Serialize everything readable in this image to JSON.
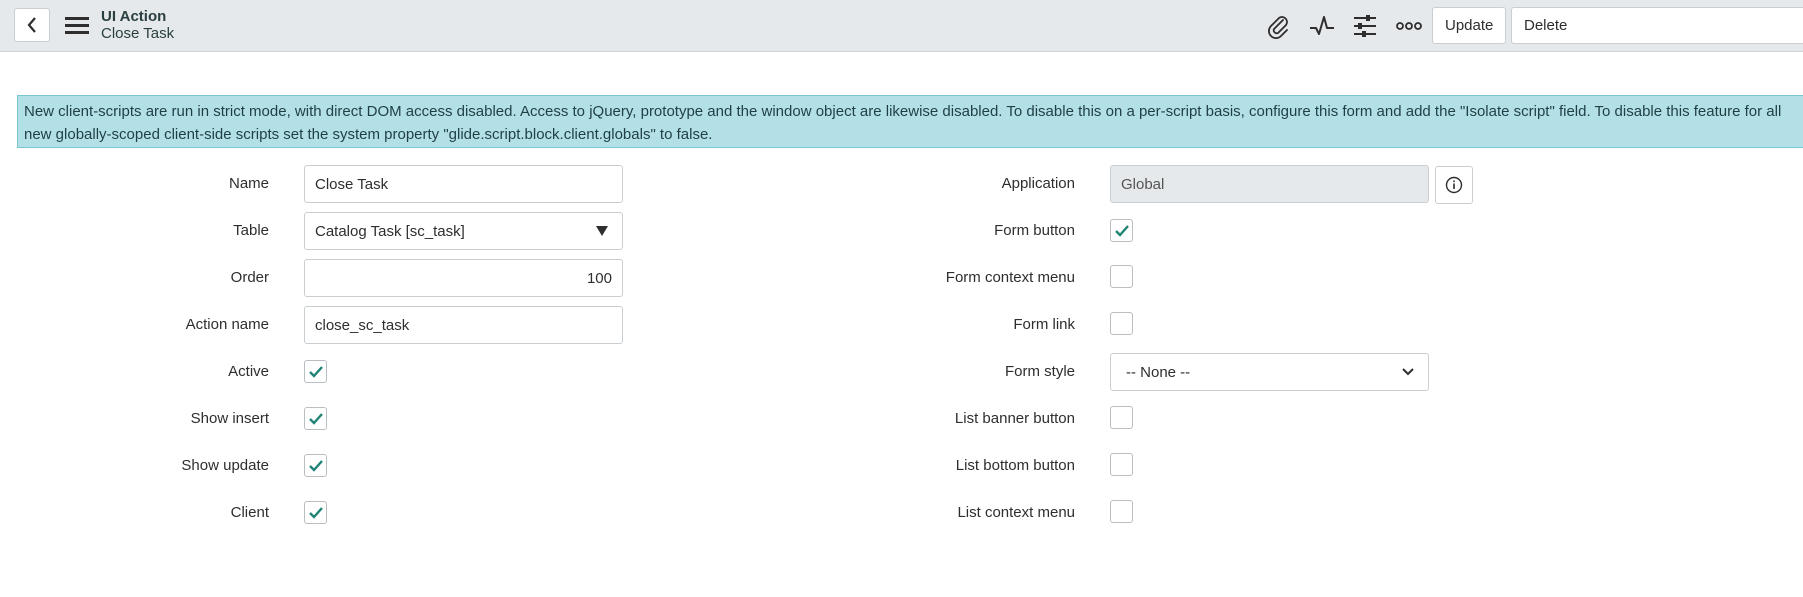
{
  "header": {
    "title": "UI Action",
    "subtitle": "Close Task",
    "buttons": {
      "update": "Update",
      "delete": "Delete"
    }
  },
  "notice": {
    "text": "New client-scripts are run in strict mode, with direct DOM access disabled. Access to jQuery, prototype and the window object are likewise disabled. To disable this on a per-script basis, configure this form and add the \"Isolate script\" field. To disable this feature for all new globally-scoped client-side scripts set the system property \"glide.script.block.client.globals\" to false."
  },
  "form_left": {
    "name": {
      "label": "Name",
      "value": "Close Task"
    },
    "table": {
      "label": "Table",
      "value": "Catalog Task [sc_task]"
    },
    "order": {
      "label": "Order",
      "value": "100"
    },
    "action_name": {
      "label": "Action name",
      "value": "close_sc_task"
    },
    "active": {
      "label": "Active",
      "checked": true
    },
    "show_insert": {
      "label": "Show insert",
      "checked": true
    },
    "show_update": {
      "label": "Show update",
      "checked": true
    },
    "client": {
      "label": "Client",
      "checked": true
    }
  },
  "form_right": {
    "application": {
      "label": "Application",
      "value": "Global"
    },
    "form_button": {
      "label": "Form button",
      "checked": true
    },
    "form_context_menu": {
      "label": "Form context menu",
      "checked": false
    },
    "form_link": {
      "label": "Form link",
      "checked": false
    },
    "form_style": {
      "label": "Form style",
      "value": "-- None --"
    },
    "list_banner_button": {
      "label": "List banner button",
      "checked": false
    },
    "list_bottom_button": {
      "label": "List bottom button",
      "checked": false
    },
    "list_context_menu": {
      "label": "List context menu",
      "checked": false
    }
  },
  "colors": {
    "accent": "#1f8476",
    "notice_bg": "#b3e0e6",
    "header_bg": "#e6e9eb"
  },
  "icons": [
    "back-arrow-icon",
    "hamburger-menu-icon",
    "paperclip-icon",
    "activity-icon",
    "settings-sliders-icon",
    "more-options-icon",
    "dropdown-arrow-icon",
    "info-icon",
    "checkmark-icon"
  ]
}
